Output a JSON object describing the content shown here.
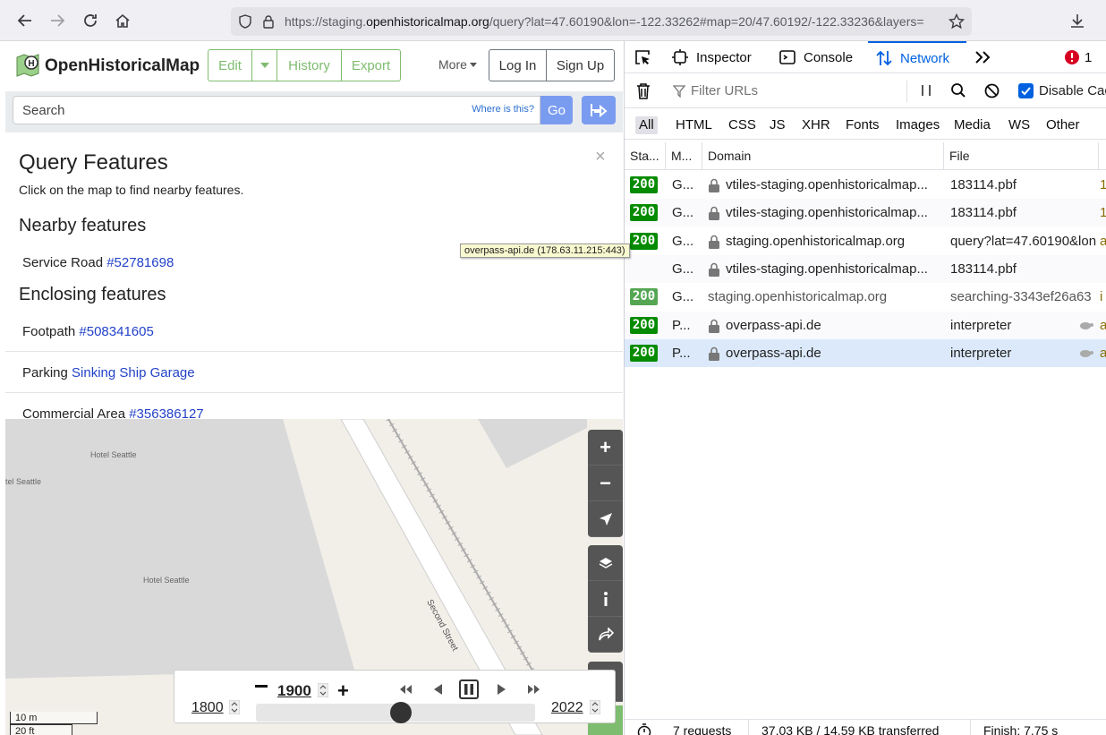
{
  "browser": {
    "url_prefix": "https://staging.",
    "url_domain": "openhistoricalmap.org",
    "url_rest": "/query?lat=47.60190&lon=-122.33262#map=20/47.60192/-122.33236&layers="
  },
  "ohm": {
    "site_name": "OpenHistoricalMap",
    "nav": {
      "edit": "Edit",
      "history": "History",
      "export": "Export",
      "more": "More",
      "login": "Log In",
      "signup": "Sign Up"
    },
    "search": {
      "placeholder": "Search",
      "where": "Where is this?",
      "go": "Go"
    },
    "query": {
      "title": "Query Features",
      "subtitle": "Click on the map to find nearby features.",
      "close": "×",
      "nearby_heading": "Nearby features",
      "nearby": [
        {
          "kind": "Service Road",
          "link": "#52781698"
        }
      ],
      "enclosing_heading": "Enclosing features",
      "enclosing": [
        {
          "kind": "Footpath",
          "link": "#508341605"
        },
        {
          "kind": "Parking",
          "link": "Sinking Ship Garage"
        },
        {
          "kind": "Commercial Area",
          "link": "#356386127"
        }
      ]
    },
    "tooltip": "overpass-api.de (178.63.11.215:443)",
    "map": {
      "labels": {
        "hotel1": "Hotel Seattle",
        "hotel2": "tel Seattle",
        "hotel3": "Hotel Seattle",
        "street": "Second Street"
      },
      "scale_m": "10 m",
      "scale_ft": "20 ft"
    },
    "timeslider": {
      "current_year": "1900",
      "start_year": "1800",
      "end_year": "2022",
      "position": 0.73
    }
  },
  "devtools": {
    "tabs": {
      "inspector": "Inspector",
      "console": "Console",
      "network": "Network"
    },
    "error_count": "1",
    "filter_placeholder": "Filter URLs",
    "disable_cache": "Disable Cac",
    "type_filters": [
      "All",
      "HTML",
      "CSS",
      "JS",
      "XHR",
      "Fonts",
      "Images",
      "Media",
      "WS",
      "Other"
    ],
    "columns": {
      "status": "Sta...",
      "method": "M...",
      "domain": "Domain",
      "file": "File"
    },
    "requests": [
      {
        "status": "200",
        "method": "G...",
        "domain": "vtiles-staging.openhistoricalmap...",
        "file": "183114.pbf",
        "lock": true,
        "cached": false,
        "selected": false,
        "extra": "1"
      },
      {
        "status": "200",
        "method": "G...",
        "domain": "vtiles-staging.openhistoricalmap...",
        "file": "183114.pbf",
        "lock": true,
        "cached": false,
        "selected": false,
        "extra": "1"
      },
      {
        "status": "200",
        "method": "G...",
        "domain": "staging.openhistoricalmap.org",
        "file": "query?lat=47.60190&lon",
        "lock": true,
        "cached": false,
        "selected": false,
        "extra": "a"
      },
      {
        "status": "",
        "method": "G...",
        "domain": "vtiles-staging.openhistoricalmap...",
        "file": "183114.pbf",
        "lock": true,
        "cached": false,
        "selected": false,
        "extra": ""
      },
      {
        "status": "200",
        "method": "G...",
        "domain": "staging.openhistoricalmap.org",
        "file": "searching-3343ef26a63",
        "lock": false,
        "cached": true,
        "selected": false,
        "extra": "i"
      },
      {
        "status": "200",
        "method": "P...",
        "domain": "overpass-api.de",
        "file": "interpreter",
        "lock": true,
        "cached": false,
        "selected": false,
        "extra": "a"
      },
      {
        "status": "200",
        "method": "P...",
        "domain": "overpass-api.de",
        "file": "interpreter",
        "lock": true,
        "cached": false,
        "selected": true,
        "extra": "a"
      }
    ],
    "status": {
      "requests": "7 requests",
      "transferred": "37.03 KB / 14.59 KB transferred",
      "finish": "Finish: 7.75 s"
    }
  }
}
